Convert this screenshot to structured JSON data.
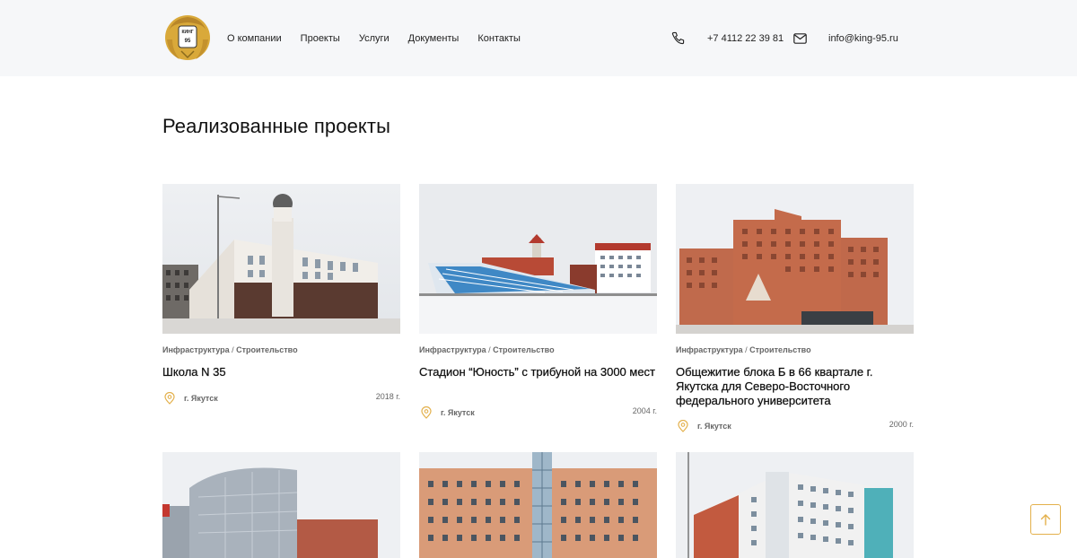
{
  "header": {
    "logo_text": "КИНГ 95",
    "nav": [
      "О компании",
      "Проекты",
      "Услуги",
      "Документы",
      "Контакты"
    ],
    "phone": "+7 4112 22 39 81",
    "email": "info@king-95.ru",
    "phone_icon": "phone-icon",
    "mail_icon": "mail-icon"
  },
  "main": {
    "title": "Реализованные проекты",
    "projects": [
      {
        "category": "Инфраструктура",
        "subcategory": "Строительство",
        "name": "Школа N 35",
        "city": "г. Якутск",
        "year": "2018 г."
      },
      {
        "category": "Инфраструктура",
        "subcategory": "Строительство",
        "name": "Стадион “Юность” с трибуной на 3000 мест",
        "city": "г. Якутск",
        "year": "2004 г."
      },
      {
        "category": "Инфраструктура",
        "subcategory": "Строительство",
        "name": "Общежитие блока Б в 66 квартале г. Якутска для Северо-Восточного федерального университета",
        "city": "г. Якутск",
        "year": "2000 г."
      }
    ],
    "separator": "/"
  },
  "colors": {
    "accent": "#e3b04b",
    "header_bg": "#f6f7f9"
  },
  "scroll_top_icon": "arrow-up-icon"
}
